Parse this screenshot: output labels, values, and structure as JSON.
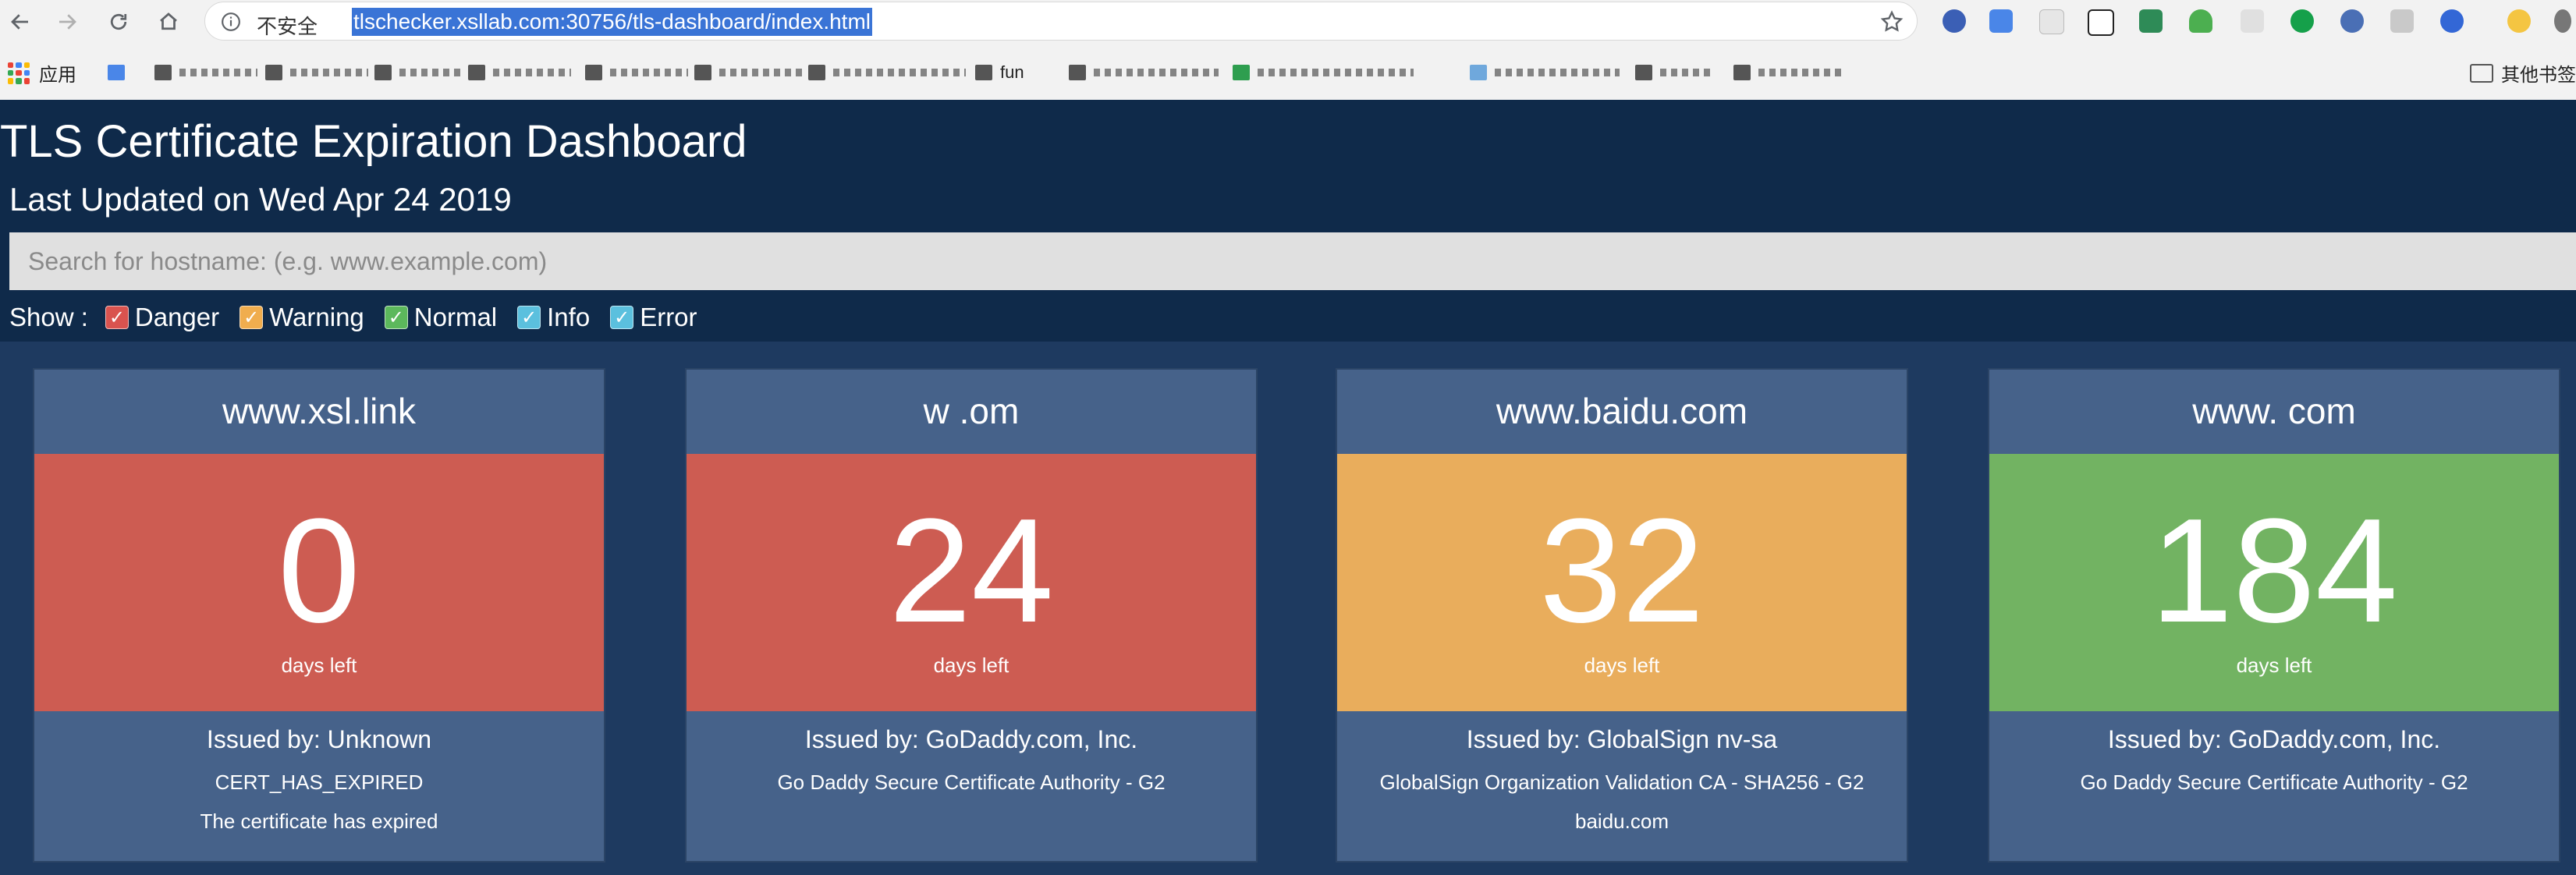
{
  "browser": {
    "security_label": "不安全",
    "url": "tlschecker.xsllab.com:30756/tls-dashboard/index.html",
    "bookmarks": {
      "apps_label": "应用",
      "fun_label": "fun",
      "other_label": "其他书签"
    }
  },
  "dashboard": {
    "title": "TLS Certificate Expiration Dashboard",
    "last_updated": "Last Updated on Wed Apr 24 2019",
    "search_placeholder": "Search for hostname: (e.g. www.example.com)",
    "show_label": "Show :",
    "filters": [
      {
        "label": "Danger",
        "color": "#d9534f",
        "checked": true
      },
      {
        "label": "Warning",
        "color": "#f0ad4e",
        "checked": true
      },
      {
        "label": "Normal",
        "color": "#5cb85c",
        "checked": true
      },
      {
        "label": "Info",
        "color": "#5bc0de",
        "checked": true
      },
      {
        "label": "Error",
        "color": "#5bc0de",
        "checked": true
      }
    ]
  },
  "cards": [
    {
      "hostname": "www.xsl.link",
      "days": "0",
      "days_label": "days left",
      "issuer": "Issued by: Unknown",
      "chain": "CERT_HAS_EXPIRED",
      "detail": "The certificate has expired",
      "color": "#cd5c52"
    },
    {
      "hostname": "w                  .om",
      "days": "24",
      "days_label": "days left",
      "issuer": "Issued by: GoDaddy.com, Inc.",
      "chain": "Go Daddy Secure Certificate Authority - G2",
      "detail": "",
      "color": "#cd5c52"
    },
    {
      "hostname": "www.baidu.com",
      "days": "32",
      "days_label": "days left",
      "issuer": "Issued by: GlobalSign nv-sa",
      "chain": "GlobalSign Organization Validation CA - SHA256 - G2",
      "detail": "baidu.com",
      "color": "#e9ad5c"
    },
    {
      "hostname": "www.               com",
      "days": "184",
      "days_label": "days left",
      "issuer": "Issued by: GoDaddy.com, Inc.",
      "chain": "Go Daddy Secure Certificate Authority - G2",
      "detail": "",
      "color": "#72b362"
    }
  ]
}
